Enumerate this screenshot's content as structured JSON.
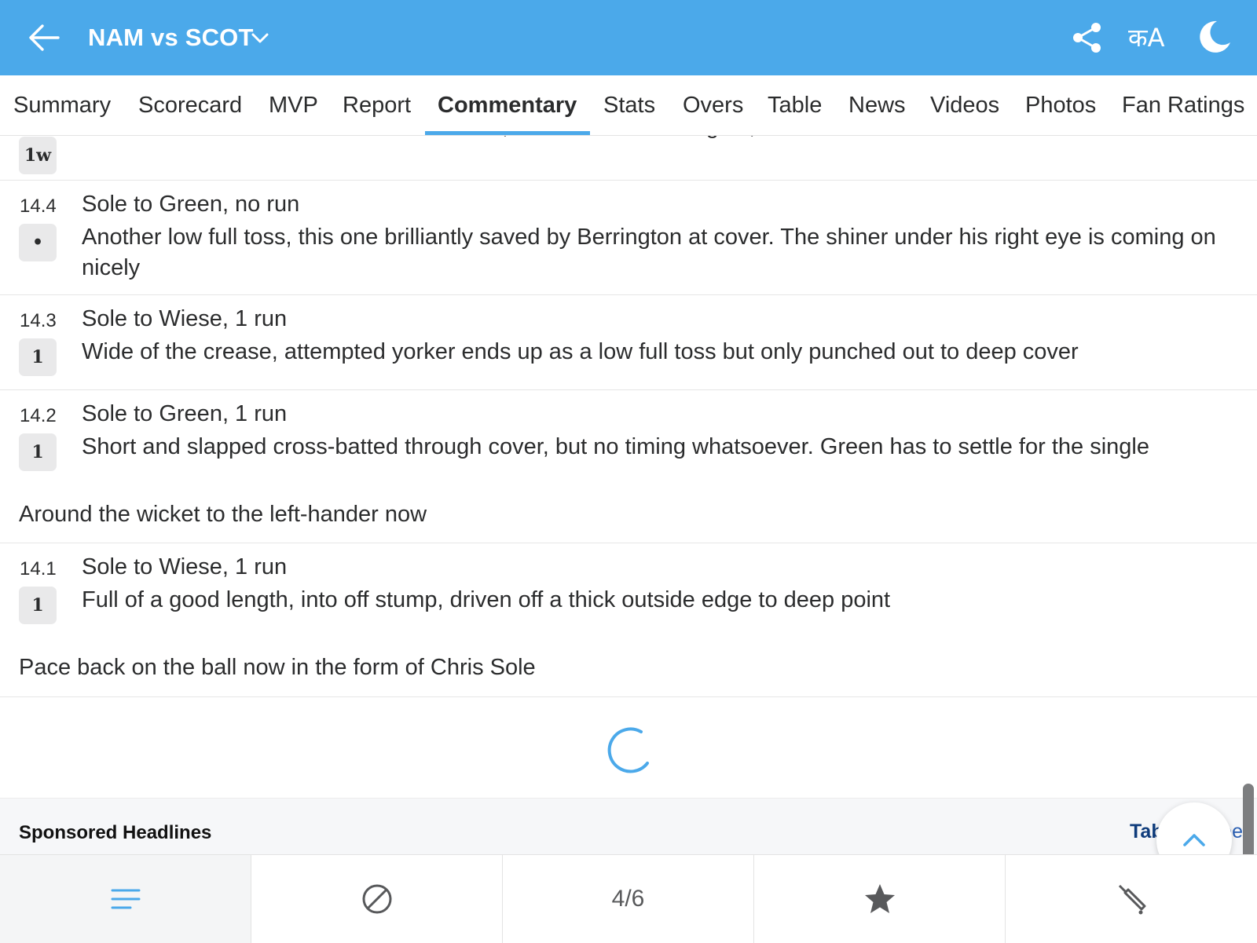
{
  "header": {
    "match_title": "NAM vs SCOT",
    "lang_label": "कA",
    "background_color": "#4ba9ea",
    "icons": [
      "back-arrow-icon",
      "chevron-down-icon",
      "share-icon",
      "moon-icon"
    ]
  },
  "tabs": [
    {
      "label": "Summary"
    },
    {
      "label": "Scorecard"
    },
    {
      "label": "MVP"
    },
    {
      "label": "Report"
    },
    {
      "label": "Commentary",
      "active": true
    },
    {
      "label": "Stats"
    },
    {
      "label": "Overs"
    },
    {
      "label": "Table"
    },
    {
      "label": "News"
    },
    {
      "label": "Videos"
    },
    {
      "label": "Photos"
    },
    {
      "label": "Fan Ratings"
    }
  ],
  "commentary": {
    "partial_row": {
      "badge": "1w",
      "text": "Slower ball out the side of the hand... well, well wide. Bowl it again, Chris"
    },
    "balls": [
      {
        "over": "14.4",
        "badge": "•",
        "title": "Sole to Green, no run",
        "text": "Another low full toss, this one brilliantly saved by Berrington at cover. The shiner under his right eye is coming on nicely"
      },
      {
        "over": "14.3",
        "badge": "1",
        "title": "Sole to Wiese, 1 run",
        "text": "Wide of the crease, attempted yorker ends up as a low full toss but only punched out to deep cover"
      },
      {
        "over": "14.2",
        "badge": "1",
        "title": "Sole to Green, 1 run",
        "text": "Short and slapped cross-batted through cover, but no timing whatsoever. Green has to settle for the single",
        "note": "Around the wicket to the left-hander now"
      },
      {
        "over": "14.1",
        "badge": "1",
        "title": "Sole to Wiese, 1 run",
        "text": "Full of a good length, into off stump, driven off a thick outside edge to deep point",
        "note": "Pace back on the ball now in the form of Chris Sole"
      }
    ]
  },
  "sponsored": {
    "title": "Sponsored Headlines",
    "brand": "Taboola",
    "brand_suffix": "Feed"
  },
  "bottom_nav": {
    "items": [
      {
        "icon": "menu-icon"
      },
      {
        "icon": "ball-icon"
      },
      {
        "label": "4/6"
      },
      {
        "icon": "star-icon"
      },
      {
        "icon": "bat-icon"
      }
    ]
  },
  "accent_color": "#4ba9ea"
}
